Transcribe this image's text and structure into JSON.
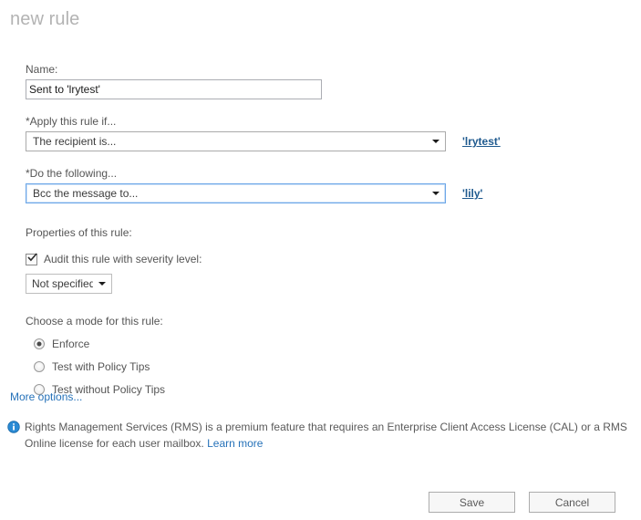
{
  "header": {
    "title": "new rule"
  },
  "form": {
    "name_label": "Name:",
    "name_value": "Sent to 'lrytest'",
    "name_placeholder": "",
    "condition_label": "*Apply this rule if...",
    "condition_selected": "The recipient is...",
    "condition_value_link": "'lrytest'",
    "action_label": "*Do the following...",
    "action_selected": "Bcc the message to...",
    "action_value_link": "'lily'",
    "properties_label": "Properties of this rule:",
    "audit_checkbox_label": "Audit this rule with severity level:",
    "audit_checked": true,
    "severity_selected": "Not specified",
    "mode_label": "Choose a mode for this rule:",
    "modes": [
      {
        "label": "Enforce",
        "checked": true
      },
      {
        "label": "Test with Policy Tips",
        "checked": false
      },
      {
        "label": "Test without Policy Tips",
        "checked": false
      }
    ],
    "more_options_label": "More options..."
  },
  "notice": {
    "icon": "info-icon",
    "text": "Rights Management Services (RMS) is a premium feature that requires an Enterprise Client Access License (CAL) or a RMS Online license for each user mailbox.",
    "link_label": "Learn more"
  },
  "footer": {
    "save_label": "Save",
    "cancel_label": "Cancel"
  },
  "colors": {
    "title": "#b3b3b3",
    "link": "#2672b9",
    "value_link": "#1f5a8f",
    "focus_border": "#6ba6e8",
    "info_icon": "#2a8ad4",
    "text": "#555555"
  }
}
